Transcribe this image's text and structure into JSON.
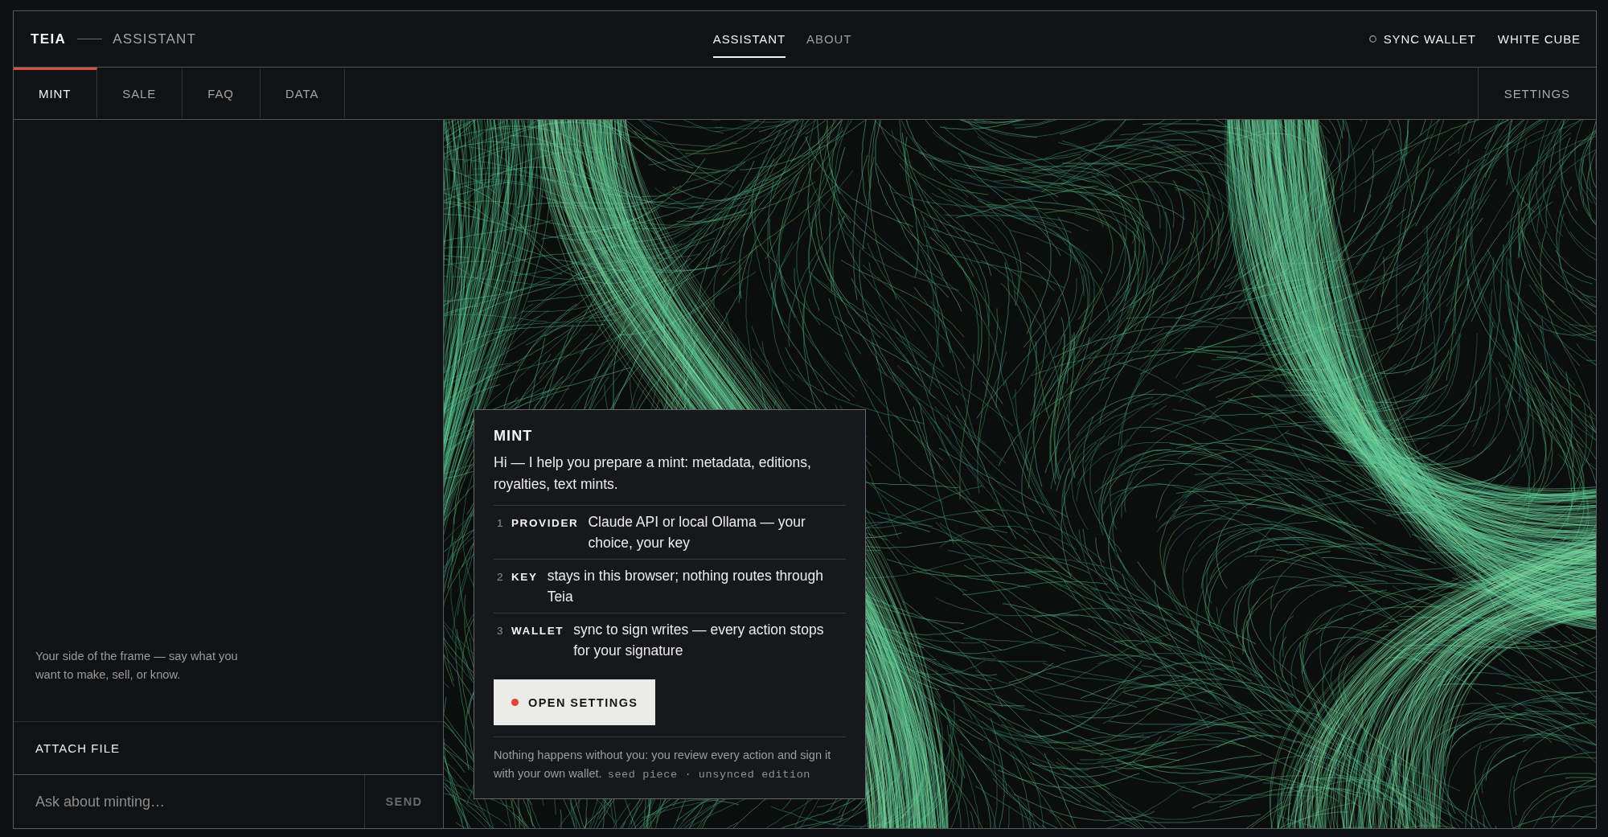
{
  "header": {
    "brand": "TEIA",
    "section": "ASSISTANT",
    "nav": [
      {
        "label": "ASSISTANT",
        "selected": true
      },
      {
        "label": "ABOUT",
        "selected": false
      }
    ],
    "wallet": {
      "label": "SYNC WALLET",
      "connected": false
    },
    "account": "WHITE CUBE"
  },
  "tabs": [
    {
      "label": "MINT",
      "selected": true
    },
    {
      "label": "SALE",
      "selected": false
    },
    {
      "label": "FAQ",
      "selected": false
    },
    {
      "label": "DATA",
      "selected": false
    }
  ],
  "settings": "SETTINGS",
  "chat": {
    "hint": "Your side of the frame — say what you want to make, sell, or know.",
    "attach": "ATTACH FILE",
    "input": {
      "placeholder": "Ask about minting…"
    },
    "send": {
      "label": "SEND",
      "disabled": true
    }
  },
  "card": {
    "title": "MINT",
    "intro": "Hi — I help you prepare a mint: metadata, editions, royalties, text mints.",
    "steps": [
      {
        "number": "1",
        "label": "PROVIDER",
        "text": "Claude API or local Ollama — your choice, your key"
      },
      {
        "number": "2",
        "label": "KEY",
        "text": "stays in this browser; nothing routes through Teia"
      },
      {
        "number": "3",
        "label": "WALLET",
        "text": "sync to sign writes — every action stops for your signature"
      }
    ],
    "button": "OPEN SETTINGS",
    "note": "Nothing happens without you: you review every action and sign it with your own wallet.",
    "edition": "seed piece · unsynced edition"
  }
}
